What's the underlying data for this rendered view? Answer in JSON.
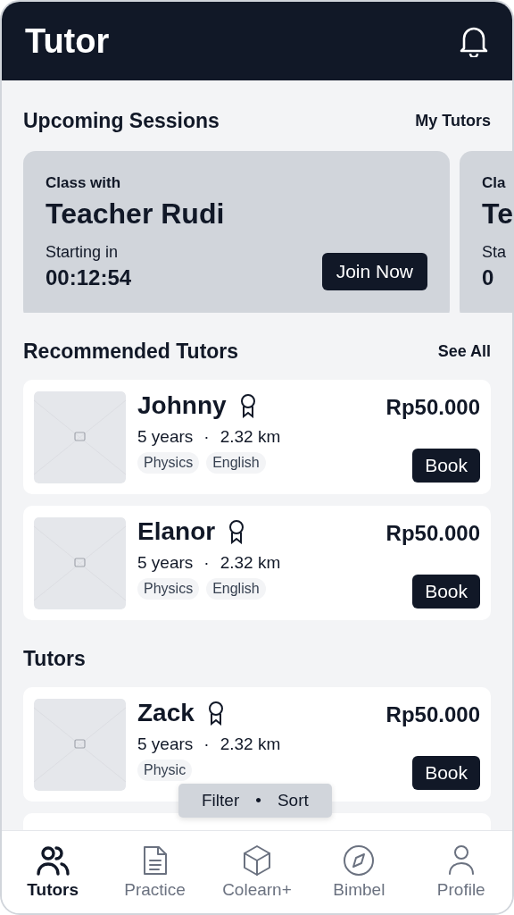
{
  "header": {
    "title": "Tutor"
  },
  "upcoming": {
    "title": "Upcoming Sessions",
    "link": "My Tutors",
    "sessions": [
      {
        "label": "Class with",
        "teacher": "Teacher Rudi",
        "starting_label": "Starting in",
        "countdown": "00:12:54",
        "button": "Join Now"
      },
      {
        "label": "Cla",
        "teacher": "Te",
        "starting_label": "Sta",
        "countdown": "0"
      }
    ]
  },
  "recommended": {
    "title": "Recommended Tutors",
    "link": "See All",
    "tutors": [
      {
        "name": "Johnny",
        "experience": "5 years",
        "separator": "·",
        "distance": "2.32 km",
        "tags": [
          "Physics",
          "English"
        ],
        "price": "Rp50.000",
        "button": "Book"
      },
      {
        "name": "Elanor",
        "experience": "5 years",
        "separator": "·",
        "distance": "2.32 km",
        "tags": [
          "Physics",
          "English"
        ],
        "price": "Rp50.000",
        "button": "Book"
      }
    ]
  },
  "tutors": {
    "title": "Tutors",
    "tutors": [
      {
        "name": "Zack",
        "experience": "5 years",
        "separator": "·",
        "distance": "2.32 km",
        "tags": [
          "Physic"
        ],
        "price": "Rp50.000",
        "button": "Book"
      }
    ]
  },
  "filter_bar": {
    "filter": "Filter",
    "separator": "•",
    "sort": "Sort"
  },
  "nav": [
    {
      "kind": "people",
      "label": "Tutors",
      "selected": true
    },
    {
      "kind": "document",
      "label": "Practice",
      "selected": false
    },
    {
      "kind": "cube",
      "label": "Colearn+",
      "selected": false
    },
    {
      "kind": "compass",
      "label": "Bimbel",
      "selected": false
    },
    {
      "kind": "person",
      "label": "Profile",
      "selected": false
    }
  ]
}
